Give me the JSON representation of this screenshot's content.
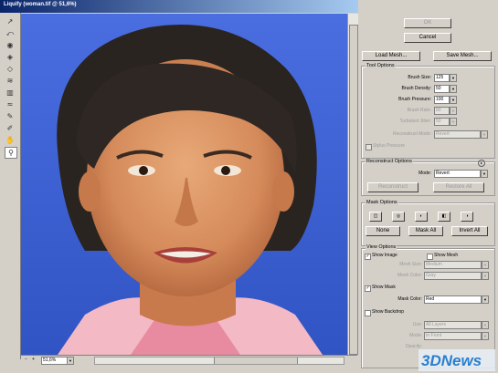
{
  "window": {
    "title": "Liquify (woman.tif @ 51,6%)"
  },
  "toolbox": {
    "tools": [
      "forward-warp-icon",
      "reconstruct-icon",
      "twirl-cw-icon",
      "pucker-icon",
      "bloat-icon",
      "push-left-icon",
      "mirror-icon",
      "turbulence-icon",
      "freeze-mask-icon",
      "thaw-mask-icon",
      "hand-icon",
      "zoom-icon"
    ]
  },
  "status": {
    "zoom": "51,6%"
  },
  "buttons": {
    "ok": "OK",
    "cancel": "Cancel",
    "load_mesh": "Load Mesh...",
    "save_mesh": "Save Mesh..."
  },
  "tool_options": {
    "title": "Tool Options",
    "brush_size_label": "Brush Size:",
    "brush_size": "125",
    "brush_density_label": "Brush Density:",
    "brush_density": "50",
    "brush_pressure_label": "Brush Pressure:",
    "brush_pressure": "100",
    "brush_rate_label": "Brush Rate:",
    "brush_rate": "80",
    "turbulent_jitter_label": "Turbulent Jitter:",
    "turbulent_jitter": "50",
    "reconstruct_mode_label": "Reconstruct Mode:",
    "reconstruct_mode": "Revert",
    "stylus_pressure": "Stylus Pressure"
  },
  "reconstruct_options": {
    "title": "Reconstruct Options",
    "mode_label": "Mode:",
    "mode": "Revert",
    "reconstruct": "Reconstruct",
    "restore_all": "Restore All"
  },
  "mask_options": {
    "title": "Mask Options",
    "none": "None",
    "mask_all": "Mask All",
    "invert_all": "Invert All"
  },
  "view_options": {
    "title": "View Options",
    "show_image": "Show Image",
    "show_mesh": "Show Mesh",
    "mesh_size_label": "Mesh Size:",
    "mesh_size": "Medium",
    "mesh_color_label": "Mesh Color:",
    "mesh_color": "Gray",
    "show_mask": "Show Mask",
    "mask_color_label": "Mask Color:",
    "mask_color": "Red",
    "show_backdrop": "Show Backdrop",
    "use_label": "Use:",
    "use": "All Layers",
    "mode_label": "Mode:",
    "mode": "In Front",
    "opacity_label": "Opacity:"
  },
  "watermark": {
    "text": "3DNews"
  },
  "colors": {
    "canvas_bg": "#3b5fd0",
    "dialog_bg": "#d4d0c8",
    "title_bar": "#0a246a"
  }
}
